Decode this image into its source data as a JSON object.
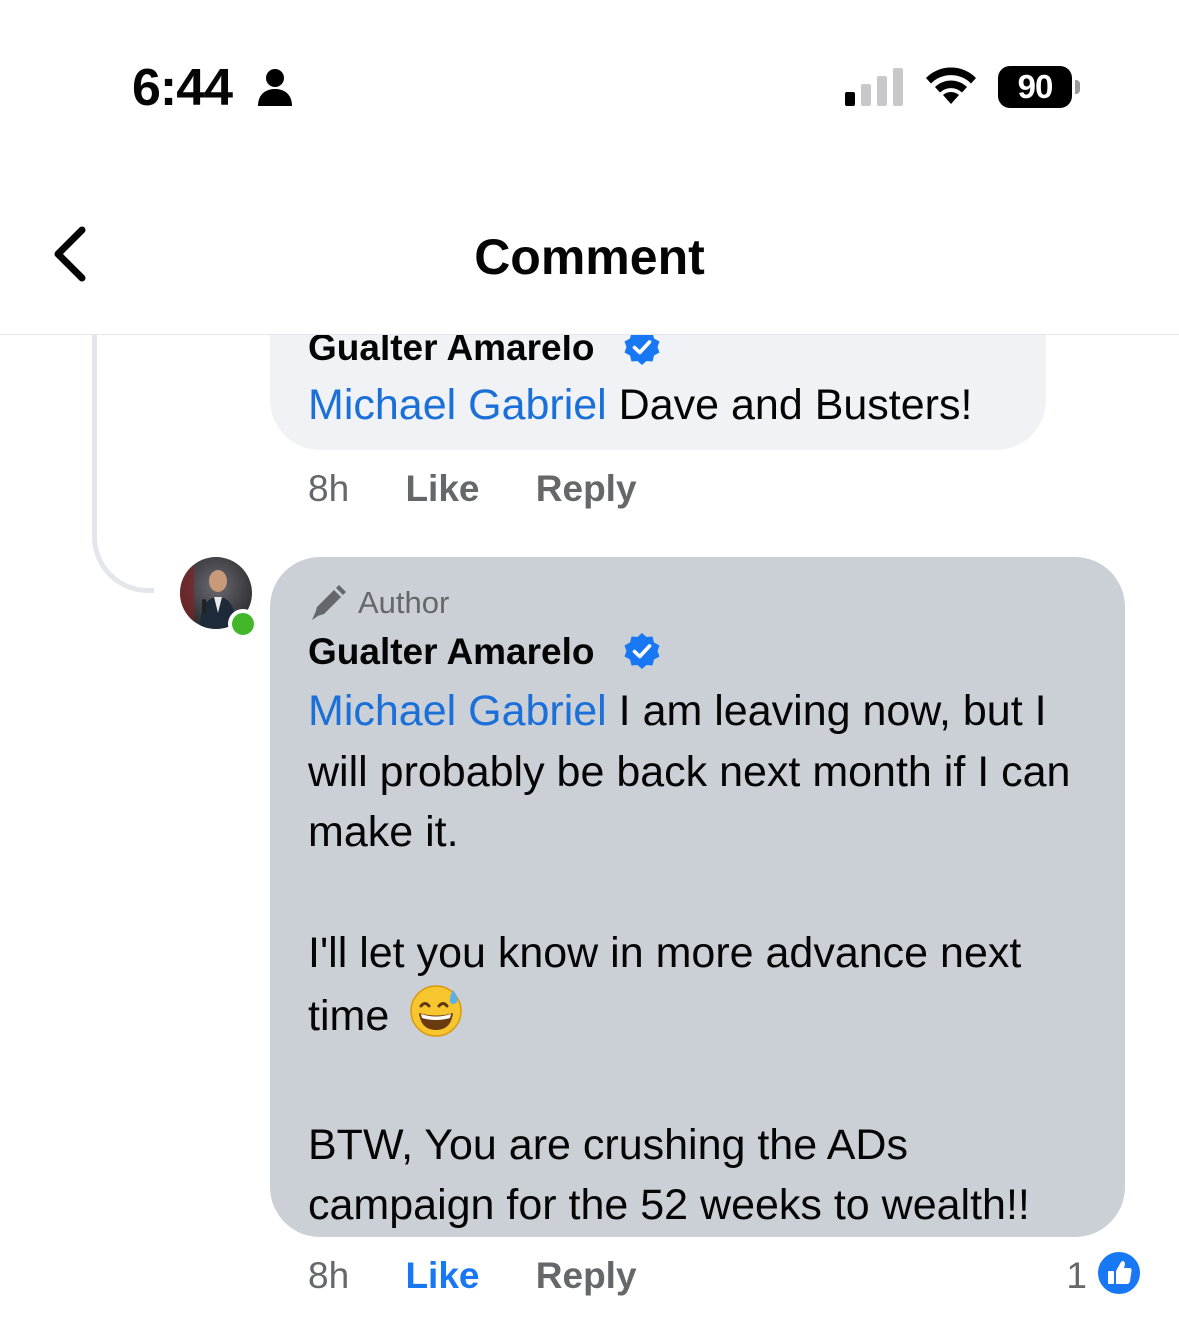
{
  "status_bar": {
    "time": "6:44",
    "battery": "90",
    "person_icon": "person-icon",
    "signal_icon": "cellular-signal-icon",
    "wifi_icon": "wifi-icon"
  },
  "nav": {
    "title": "Comment",
    "back_icon": "chevron-left-icon"
  },
  "comments": [
    {
      "name": "Gualter Amarelo",
      "verified": true,
      "mention": "Michael Gabriel",
      "text": " Dave and Busters!",
      "time": "8h",
      "like_label": "Like",
      "reply_label": "Reply"
    },
    {
      "badge": "Author",
      "badge_icon": "pen-icon",
      "name": "Gualter Amarelo",
      "verified": true,
      "online": true,
      "mention": "Michael Gabriel",
      "lines": {
        "p1_rest": " I am leaving now, but I will probably be back next month if I can make it.",
        "p2": "I'll let you know in more advance next time",
        "p2_emoji": "😅",
        "p3": "BTW, You are crushing the ADs campaign for the 52 weeks to wealth!!"
      },
      "time": "8h",
      "like_label": "Like",
      "like_active": true,
      "reply_label": "Reply",
      "reaction_count": "1",
      "reaction_icon": "thumbs-up-icon"
    }
  ],
  "colors": {
    "mention": "#1a6fd8",
    "verified": "#1877f2",
    "author_bubble": "#cbcfd6",
    "reply_bubble": "#f0f2f5",
    "online": "#42b72a"
  }
}
